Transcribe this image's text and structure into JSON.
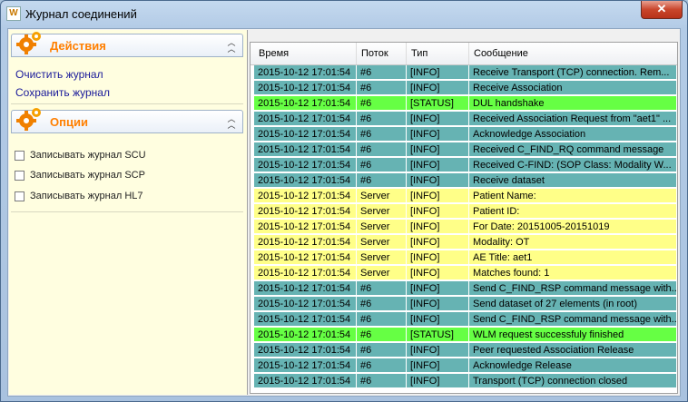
{
  "window": {
    "title": "Журнал соединений",
    "close_glyph": "✕",
    "app_icon_glyph": "W"
  },
  "left": {
    "actions": {
      "title": "Действия",
      "links": [
        "Очистить журнал",
        "Сохранить журнал"
      ]
    },
    "options": {
      "title": "Опции",
      "checkboxes": [
        {
          "label": "Записывать журнал SCU",
          "checked": false
        },
        {
          "label": "Записывать журнал SCP",
          "checked": false
        },
        {
          "label": "Записывать журнал HL7",
          "checked": false
        }
      ]
    }
  },
  "grid": {
    "columns": [
      "Время",
      "Поток",
      "Тип",
      "Сообщение"
    ],
    "colors": {
      "teal": "#66b3b3",
      "green": "#66ff44",
      "yellow": "#ffff88"
    },
    "rows": [
      {
        "time": "2015-10-12 17:01:54",
        "thread": "#6",
        "type": "[INFO]",
        "message": "Receive Transport (TCP) connection. Rem...",
        "color": "teal"
      },
      {
        "time": "2015-10-12 17:01:54",
        "thread": "#6",
        "type": "[INFO]",
        "message": "Receive Association",
        "color": "teal"
      },
      {
        "time": "2015-10-12 17:01:54",
        "thread": "#6",
        "type": "[STATUS]",
        "message": "DUL handshake",
        "color": "green"
      },
      {
        "time": "2015-10-12 17:01:54",
        "thread": "#6",
        "type": "[INFO]",
        "message": "Received Association Request from \"aet1\" ...",
        "color": "teal"
      },
      {
        "time": "2015-10-12 17:01:54",
        "thread": "#6",
        "type": "[INFO]",
        "message": "Acknowledge Association",
        "color": "teal"
      },
      {
        "time": "2015-10-12 17:01:54",
        "thread": "#6",
        "type": "[INFO]",
        "message": "Received C_FIND_RQ command message",
        "color": "teal"
      },
      {
        "time": "2015-10-12 17:01:54",
        "thread": "#6",
        "type": "[INFO]",
        "message": "Received C-FIND: (SOP Class: Modality W...",
        "color": "teal"
      },
      {
        "time": "2015-10-12 17:01:54",
        "thread": "#6",
        "type": "[INFO]",
        "message": "Receive dataset",
        "color": "teal"
      },
      {
        "time": "2015-10-12 17:01:54",
        "thread": "Server",
        "type": "[INFO]",
        "message": "Patient Name:",
        "color": "yellow"
      },
      {
        "time": "2015-10-12 17:01:54",
        "thread": "Server",
        "type": "[INFO]",
        "message": "Patient ID:",
        "color": "yellow"
      },
      {
        "time": "2015-10-12 17:01:54",
        "thread": "Server",
        "type": "[INFO]",
        "message": "For Date: 20151005-20151019",
        "color": "yellow"
      },
      {
        "time": "2015-10-12 17:01:54",
        "thread": "Server",
        "type": "[INFO]",
        "message": "Modality: OT",
        "color": "yellow"
      },
      {
        "time": "2015-10-12 17:01:54",
        "thread": "Server",
        "type": "[INFO]",
        "message": "AE Title: aet1",
        "color": "yellow"
      },
      {
        "time": "2015-10-12 17:01:54",
        "thread": "Server",
        "type": "[INFO]",
        "message": "Matches found: 1",
        "color": "yellow"
      },
      {
        "time": "2015-10-12 17:01:54",
        "thread": "#6",
        "type": "[INFO]",
        "message": "Send C_FIND_RSP command message with...",
        "color": "teal"
      },
      {
        "time": "2015-10-12 17:01:54",
        "thread": "#6",
        "type": "[INFO]",
        "message": "Send dataset of 27 elements (in root)",
        "color": "teal"
      },
      {
        "time": "2015-10-12 17:01:54",
        "thread": "#6",
        "type": "[INFO]",
        "message": "Send C_FIND_RSP command message with...",
        "color": "teal"
      },
      {
        "time": "2015-10-12 17:01:54",
        "thread": "#6",
        "type": "[STATUS]",
        "message": "WLM request successfuly finished",
        "color": "green"
      },
      {
        "time": "2015-10-12 17:01:54",
        "thread": "#6",
        "type": "[INFO]",
        "message": "Peer requested Association Release",
        "color": "teal"
      },
      {
        "time": "2015-10-12 17:01:54",
        "thread": "#6",
        "type": "[INFO]",
        "message": "Acknowledge Release",
        "color": "teal"
      },
      {
        "time": "2015-10-12 17:01:54",
        "thread": "#6",
        "type": "[INFO]",
        "message": "Transport (TCP) connection closed",
        "color": "teal"
      }
    ]
  }
}
